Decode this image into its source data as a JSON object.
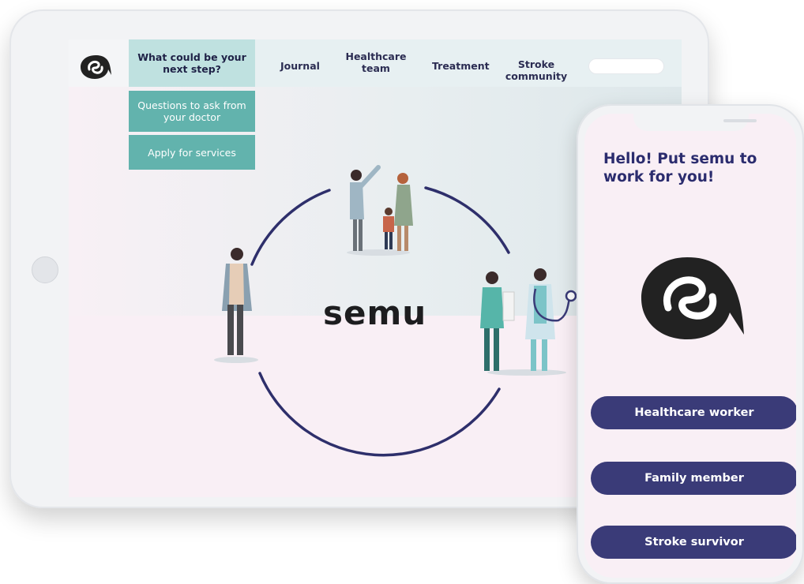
{
  "tablet": {
    "menu": {
      "next_step": "What could be your next step?",
      "questions": "Questions to ask from your doctor",
      "apply": "Apply for services"
    },
    "nav": {
      "journal": "Journal",
      "healthcare_team": "Healthcare team",
      "treatment": "Treatment",
      "stroke_community": "Stroke community"
    },
    "brand": "semu"
  },
  "phone": {
    "greeting": "Hello! Put semu to work for you!",
    "buttons": [
      {
        "label": "Healthcare worker"
      },
      {
        "label": "Family member"
      },
      {
        "label": "Stroke survivor"
      }
    ]
  },
  "colors": {
    "navy": "#3a3b78",
    "teal": "#62b3ad",
    "light_teal": "#bfe1e0",
    "pink_bg": "#f9eff5"
  },
  "icons": [
    "semu-logo-icon",
    "search-field",
    "home-button"
  ]
}
